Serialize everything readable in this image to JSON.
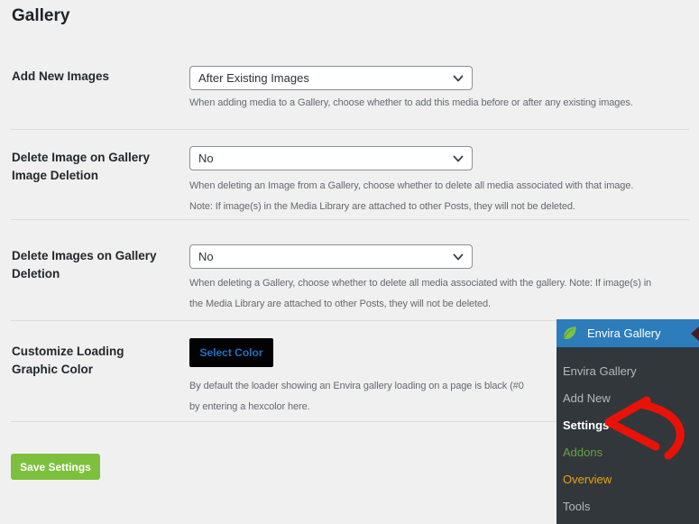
{
  "page": {
    "title": "Gallery"
  },
  "colors": {
    "page_bg": "#f0f0f1",
    "heading": "#1d2327",
    "description_text": "#646970",
    "divider": "#dcdcde",
    "select_border": "#8c8f94",
    "save_button_bg": "#7cc03e",
    "select_color_button_bg": "#030303",
    "select_color_button_text": "#2170c2",
    "menu_header_bg": "#2d7cbc",
    "menu_bg": "#32373c",
    "leaf_green": "#7dc246",
    "arrow_red": "#ea1207"
  },
  "settings": [
    {
      "label_lines": [
        "Add New Images"
      ],
      "control": "select",
      "value": "After Existing Images",
      "description_lines": [
        "When adding media to a Gallery, choose whether to add this media before or after any existing images."
      ]
    },
    {
      "label_lines": [
        "Delete Image on Gallery",
        "Image Deletion"
      ],
      "control": "select",
      "value": "No",
      "description_lines": [
        "When deleting an Image from a Gallery, choose whether to delete all media associated with that image.",
        "Note: If image(s) in the Media Library are attached to other Posts, they will not be deleted."
      ]
    },
    {
      "label_lines": [
        "Delete Images on Gallery",
        "Deletion"
      ],
      "control": "select",
      "value": "No",
      "description_lines": [
        "When deleting a Gallery, choose whether to delete all media associated with the gallery. Note: If image(s) in",
        "the Media Library are attached to other Posts, they will not be deleted."
      ]
    },
    {
      "label_lines": [
        "Customize Loading",
        "Graphic Color"
      ],
      "control": "button",
      "button_label": "Select Color",
      "description_lines": [
        "By default the loader showing an Envira gallery loading on a page is black (#0",
        "by entering a hexcolor here."
      ]
    }
  ],
  "save_button": {
    "label": "Save Settings"
  },
  "menu": {
    "header": {
      "label": "Envira Gallery",
      "icon": "envira-leaf-icon"
    },
    "items": [
      {
        "label": "Envira Gallery",
        "color": "#b4b9be",
        "active": false
      },
      {
        "label": "Add New",
        "color": "#b4b9be",
        "active": false
      },
      {
        "label": "Settings",
        "color": "#ffffff",
        "active": true
      },
      {
        "label": "Addons",
        "color": "#68a33f",
        "active": false
      },
      {
        "label": "Overview",
        "color": "#f0a00c",
        "active": false
      },
      {
        "label": "Tools",
        "color": "#b4b9be",
        "active": false
      }
    ]
  },
  "annotation": {
    "type": "hand-drawn-arrow",
    "color": "#ea1207",
    "points_to": "Settings"
  }
}
